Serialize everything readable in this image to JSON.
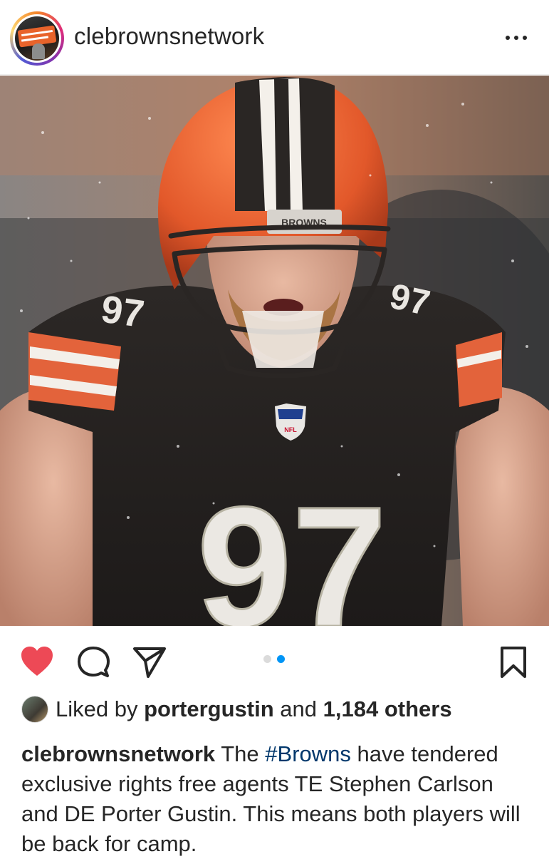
{
  "post": {
    "username": "clebrownsnetwork",
    "avatar_icon": "clebrowns-network-logo",
    "more_icon": "more-horizontal-icon",
    "photo_text": {
      "helmet_bumper": "BROWNS",
      "shield": "NFL",
      "jersey_number": "97"
    },
    "actions": {
      "like_icon": "heart-filled-icon",
      "like_color": "#ed4956",
      "comment_icon": "comment-icon",
      "share_icon": "send-icon",
      "save_icon": "bookmark-icon"
    },
    "carousel": {
      "total": 2,
      "active": 2,
      "active_color": "#0095f6",
      "inactive_color": "#dbdbdb"
    },
    "likes": {
      "prefix": "Liked by",
      "user": "portergustin",
      "conjunction": "and",
      "others": "1,184 others"
    },
    "caption": {
      "username": "clebrownsnetwork",
      "before": "The",
      "hashtag": "#Browns",
      "after": "have tendered exclusive rights free agents TE Stephen Carlson and DE Porter Gustin. This means both players will be back for camp."
    }
  }
}
